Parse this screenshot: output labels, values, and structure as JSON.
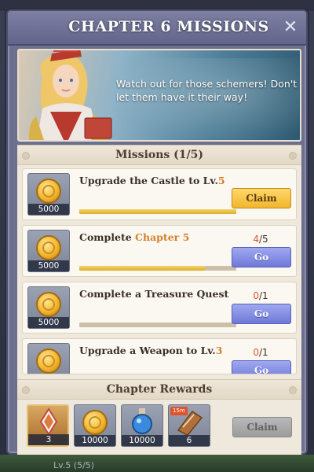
{
  "dialog": {
    "title": "CHAPTER 6 MISSIONS",
    "close_icon": "close-icon"
  },
  "banner": {
    "message": "Watch out for those schemers! Don't let them have it their way!"
  },
  "missions_header": "Missions (1/5)",
  "missions": [
    {
      "text_pre": "Upgrade the Castle to Lv.",
      "text_hl": "5",
      "reward": "5000",
      "progress": 1.0,
      "count_done": "",
      "count_total": "",
      "button": "Claim",
      "button_kind": "claim"
    },
    {
      "text_pre": "Complete ",
      "text_hl": "Chapter 5",
      "reward": "5000",
      "progress": 0.8,
      "count_done": "4",
      "count_total": "/5",
      "button": "Go",
      "button_kind": "go"
    },
    {
      "text_pre": "Complete a Treasure Quest",
      "text_hl": "",
      "reward": "5000",
      "progress": 0.0,
      "count_done": "0",
      "count_total": "/1",
      "button": "Go",
      "button_kind": "go"
    },
    {
      "text_pre": "Upgrade a Weapon to Lv.",
      "text_hl": "3",
      "reward": "",
      "progress": 0.0,
      "count_done": "0",
      "count_total": "/1",
      "button": "Go",
      "button_kind": "go"
    }
  ],
  "chapter_rewards": {
    "header": "Chapter Rewards",
    "items": [
      {
        "icon": "hero-shard-icon",
        "amount": "3"
      },
      {
        "icon": "gold-coin-icon",
        "amount": "10000"
      },
      {
        "icon": "potion-icon",
        "amount": "10000"
      },
      {
        "icon": "speedup-scroll-icon",
        "amount": "6",
        "badge": "15m"
      }
    ],
    "claim_label": "Claim"
  },
  "background": {
    "footer_text": "Lv.5 (5/5)"
  },
  "colors": {
    "claim_button": "#f2b52c",
    "go_button": "#6f79d8",
    "highlight": "#d4802a",
    "count_done": "#e0542c"
  }
}
